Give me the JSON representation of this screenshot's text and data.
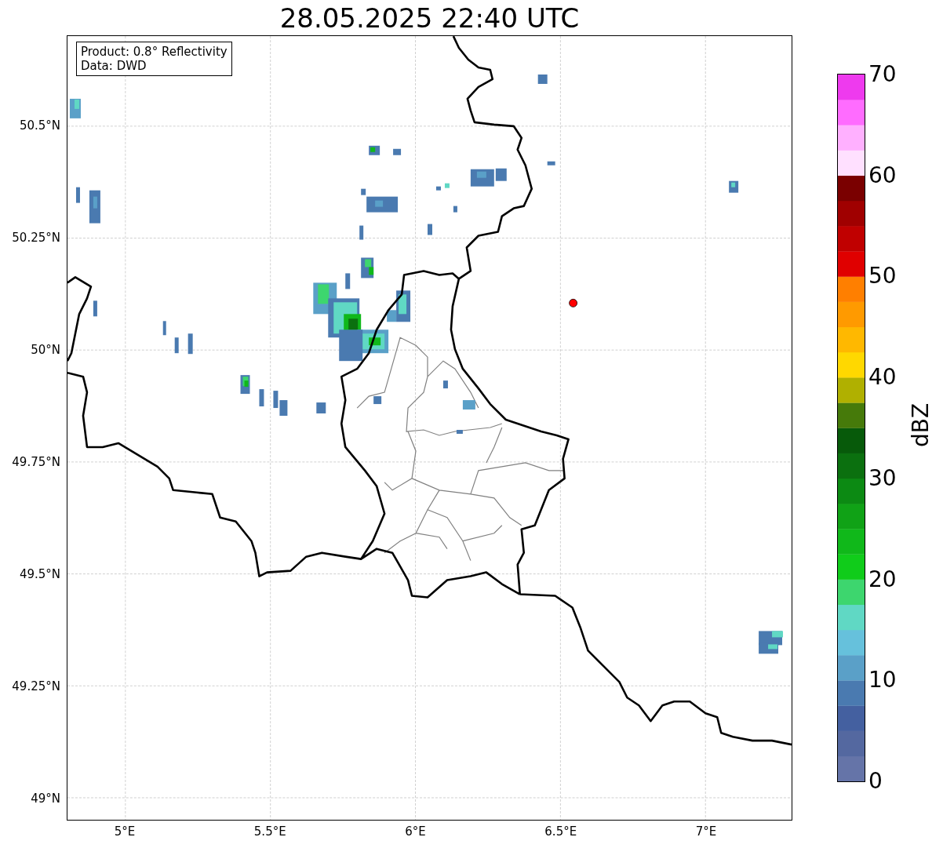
{
  "title": "28.05.2025 22:40 UTC",
  "info_box": {
    "lines": [
      "Product: 0.8° Reflectivity",
      "Data: DWD"
    ]
  },
  "map": {
    "lat_ticks": [
      "50.5°N",
      "50.25°N",
      "50°N",
      "49.75°N",
      "49.5°N",
      "49.25°N",
      "49°N"
    ],
    "lon_ticks": [
      "5°E",
      "5.5°E",
      "6°E",
      "6.5°E",
      "7°E"
    ]
  },
  "colorbar": {
    "label": "dBZ",
    "ticks": [
      "70",
      "60",
      "50",
      "40",
      "30",
      "20",
      "10",
      "0"
    ],
    "segments": [
      {
        "color": "#6574a8"
      },
      {
        "color": "#5468a0"
      },
      {
        "color": "#4460a0"
      },
      {
        "color": "#4a7ab0"
      },
      {
        "color": "#5aa0c8"
      },
      {
        "color": "#66c1dc"
      },
      {
        "color": "#60d8c4"
      },
      {
        "color": "#3dd66e"
      },
      {
        "color": "#10cc1a"
      },
      {
        "color": "#10b81a"
      },
      {
        "color": "#10a216"
      },
      {
        "color": "#0c8a13"
      },
      {
        "color": "#0b700f"
      },
      {
        "color": "#075a0a"
      },
      {
        "color": "#467a0a"
      },
      {
        "color": "#b0b000"
      },
      {
        "color": "#ffd800"
      },
      {
        "color": "#ffb800"
      },
      {
        "color": "#ff9a00"
      },
      {
        "color": "#ff7f00"
      },
      {
        "color": "#e00000"
      },
      {
        "color": "#c00000"
      },
      {
        "color": "#a00000"
      },
      {
        "color": "#7a0000"
      },
      {
        "color": "#ffe0ff"
      },
      {
        "color": "#ffb0ff"
      },
      {
        "color": "#ff6cff"
      },
      {
        "color": "#ee3aee"
      }
    ]
  }
}
